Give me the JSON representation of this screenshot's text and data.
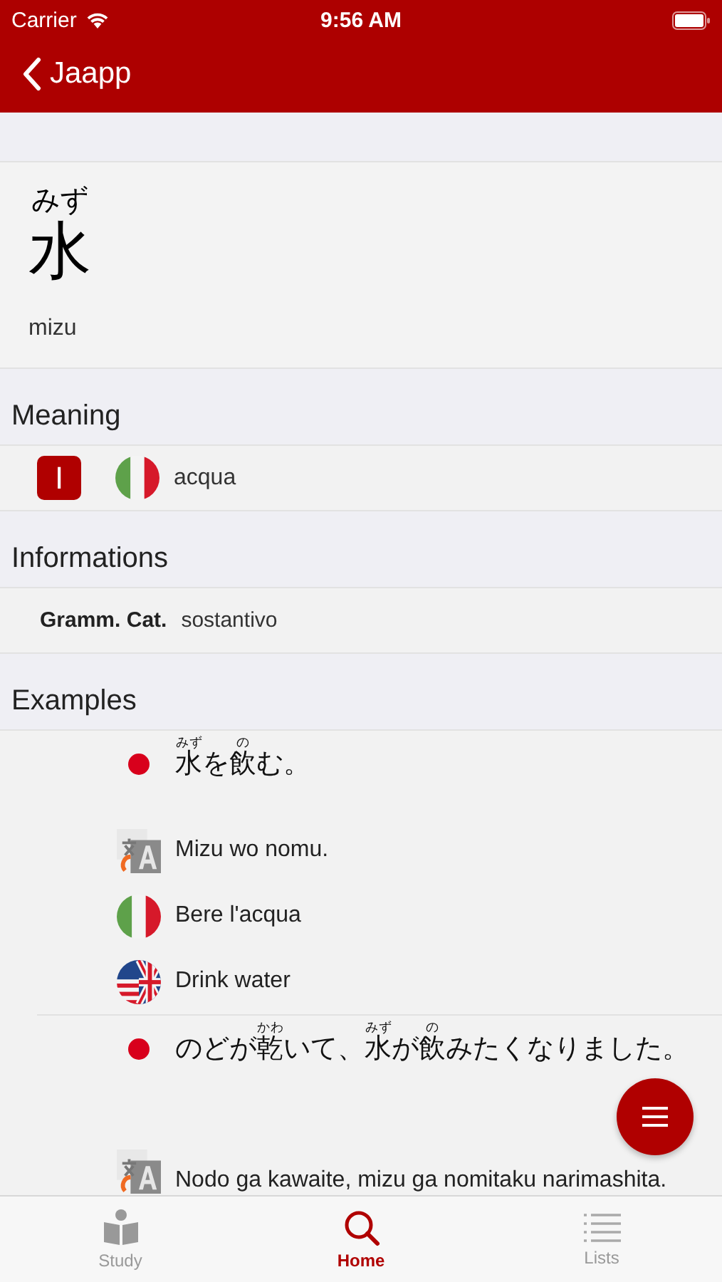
{
  "status_bar": {
    "carrier": "Carrier",
    "time": "9:56 AM"
  },
  "nav": {
    "back": "Jaapp"
  },
  "word": {
    "reading": "みず",
    "kanji": "水",
    "romaji": "mizu"
  },
  "meaning": {
    "title": "Meaning",
    "items": [
      {
        "badge": "I",
        "kind": "italian",
        "text": "acqua"
      }
    ]
  },
  "informations": {
    "title": "Informations",
    "items": [
      {
        "label": "Gramm. Cat.",
        "value": "sostantivo"
      }
    ]
  },
  "examples": {
    "title": "Examples",
    "items": [
      {
        "lines": [
          {
            "kind": "japanese",
            "segments": [
              {
                "text": "水",
                "ruby": "みず"
              },
              {
                "text": "を"
              },
              {
                "text": "飲",
                "ruby": "の"
              },
              {
                "text": "む。"
              }
            ]
          },
          {
            "kind": "romaji",
            "text": "Mizu wo nomu."
          },
          {
            "kind": "italian",
            "text": "Bere l'acqua"
          },
          {
            "kind": "english",
            "text": "Drink water"
          }
        ]
      },
      {
        "lines": [
          {
            "kind": "japanese",
            "segments": [
              {
                "text": "のどが"
              },
              {
                "text": "乾",
                "ruby": "かわ"
              },
              {
                "text": "いて、"
              },
              {
                "text": "水",
                "ruby": "みず"
              },
              {
                "text": "が"
              },
              {
                "text": "飲",
                "ruby": "の"
              },
              {
                "text": "みたくなりました。"
              }
            ]
          },
          {
            "kind": "romaji",
            "text": "Nodo ga kawaite, mizu ga nomitaku narimashita."
          }
        ]
      }
    ]
  },
  "tabs": [
    {
      "label": "Study",
      "selected": false
    },
    {
      "label": "Home",
      "selected": true
    },
    {
      "label": "Lists",
      "selected": false
    }
  ]
}
